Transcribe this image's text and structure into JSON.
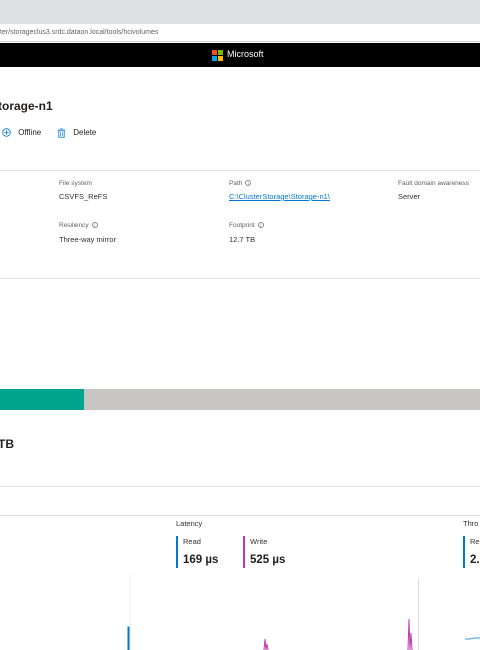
{
  "browser": {
    "url": "ter/storageclus3.srdc.dataon.local/tools/hcivolumes"
  },
  "brand": {
    "title": "Microsoft",
    "logo_colors": [
      "#f25022",
      "#7fba00",
      "#00a4ef",
      "#ffb900"
    ]
  },
  "volume": {
    "title": "torage-n1"
  },
  "toolbar": {
    "offline_label": "Offline",
    "delete_label": "Delete"
  },
  "properties": {
    "file_system_label": "File system",
    "file_system_value": "CSVFS_ReFS",
    "path_label": "Path",
    "path_value": "C:\\ClusterStorage\\Storage-n1\\",
    "fault_domain_label": "Fault domain awareness",
    "fault_domain_value": "Server",
    "resiliency_label": "Resiliency",
    "resiliency_value": "Three-way mirror",
    "footprint_label": "Footprint",
    "footprint_value": "12.7 TB"
  },
  "capacity": {
    "used_fraction": 0.175,
    "used_color": "#00a38b",
    "free_color": "#c8c6c4",
    "text": "TB"
  },
  "performance": {
    "latency_label": "Latency",
    "read_label": "Read",
    "read_value": "169 µs",
    "read_color": "#0078d4",
    "write_label": "Write",
    "write_value": "525 µs",
    "write_color": "#c239b3",
    "throughput_label": "Thro",
    "throughput_read_label": "Rea",
    "throughput_read_value": "2."
  }
}
